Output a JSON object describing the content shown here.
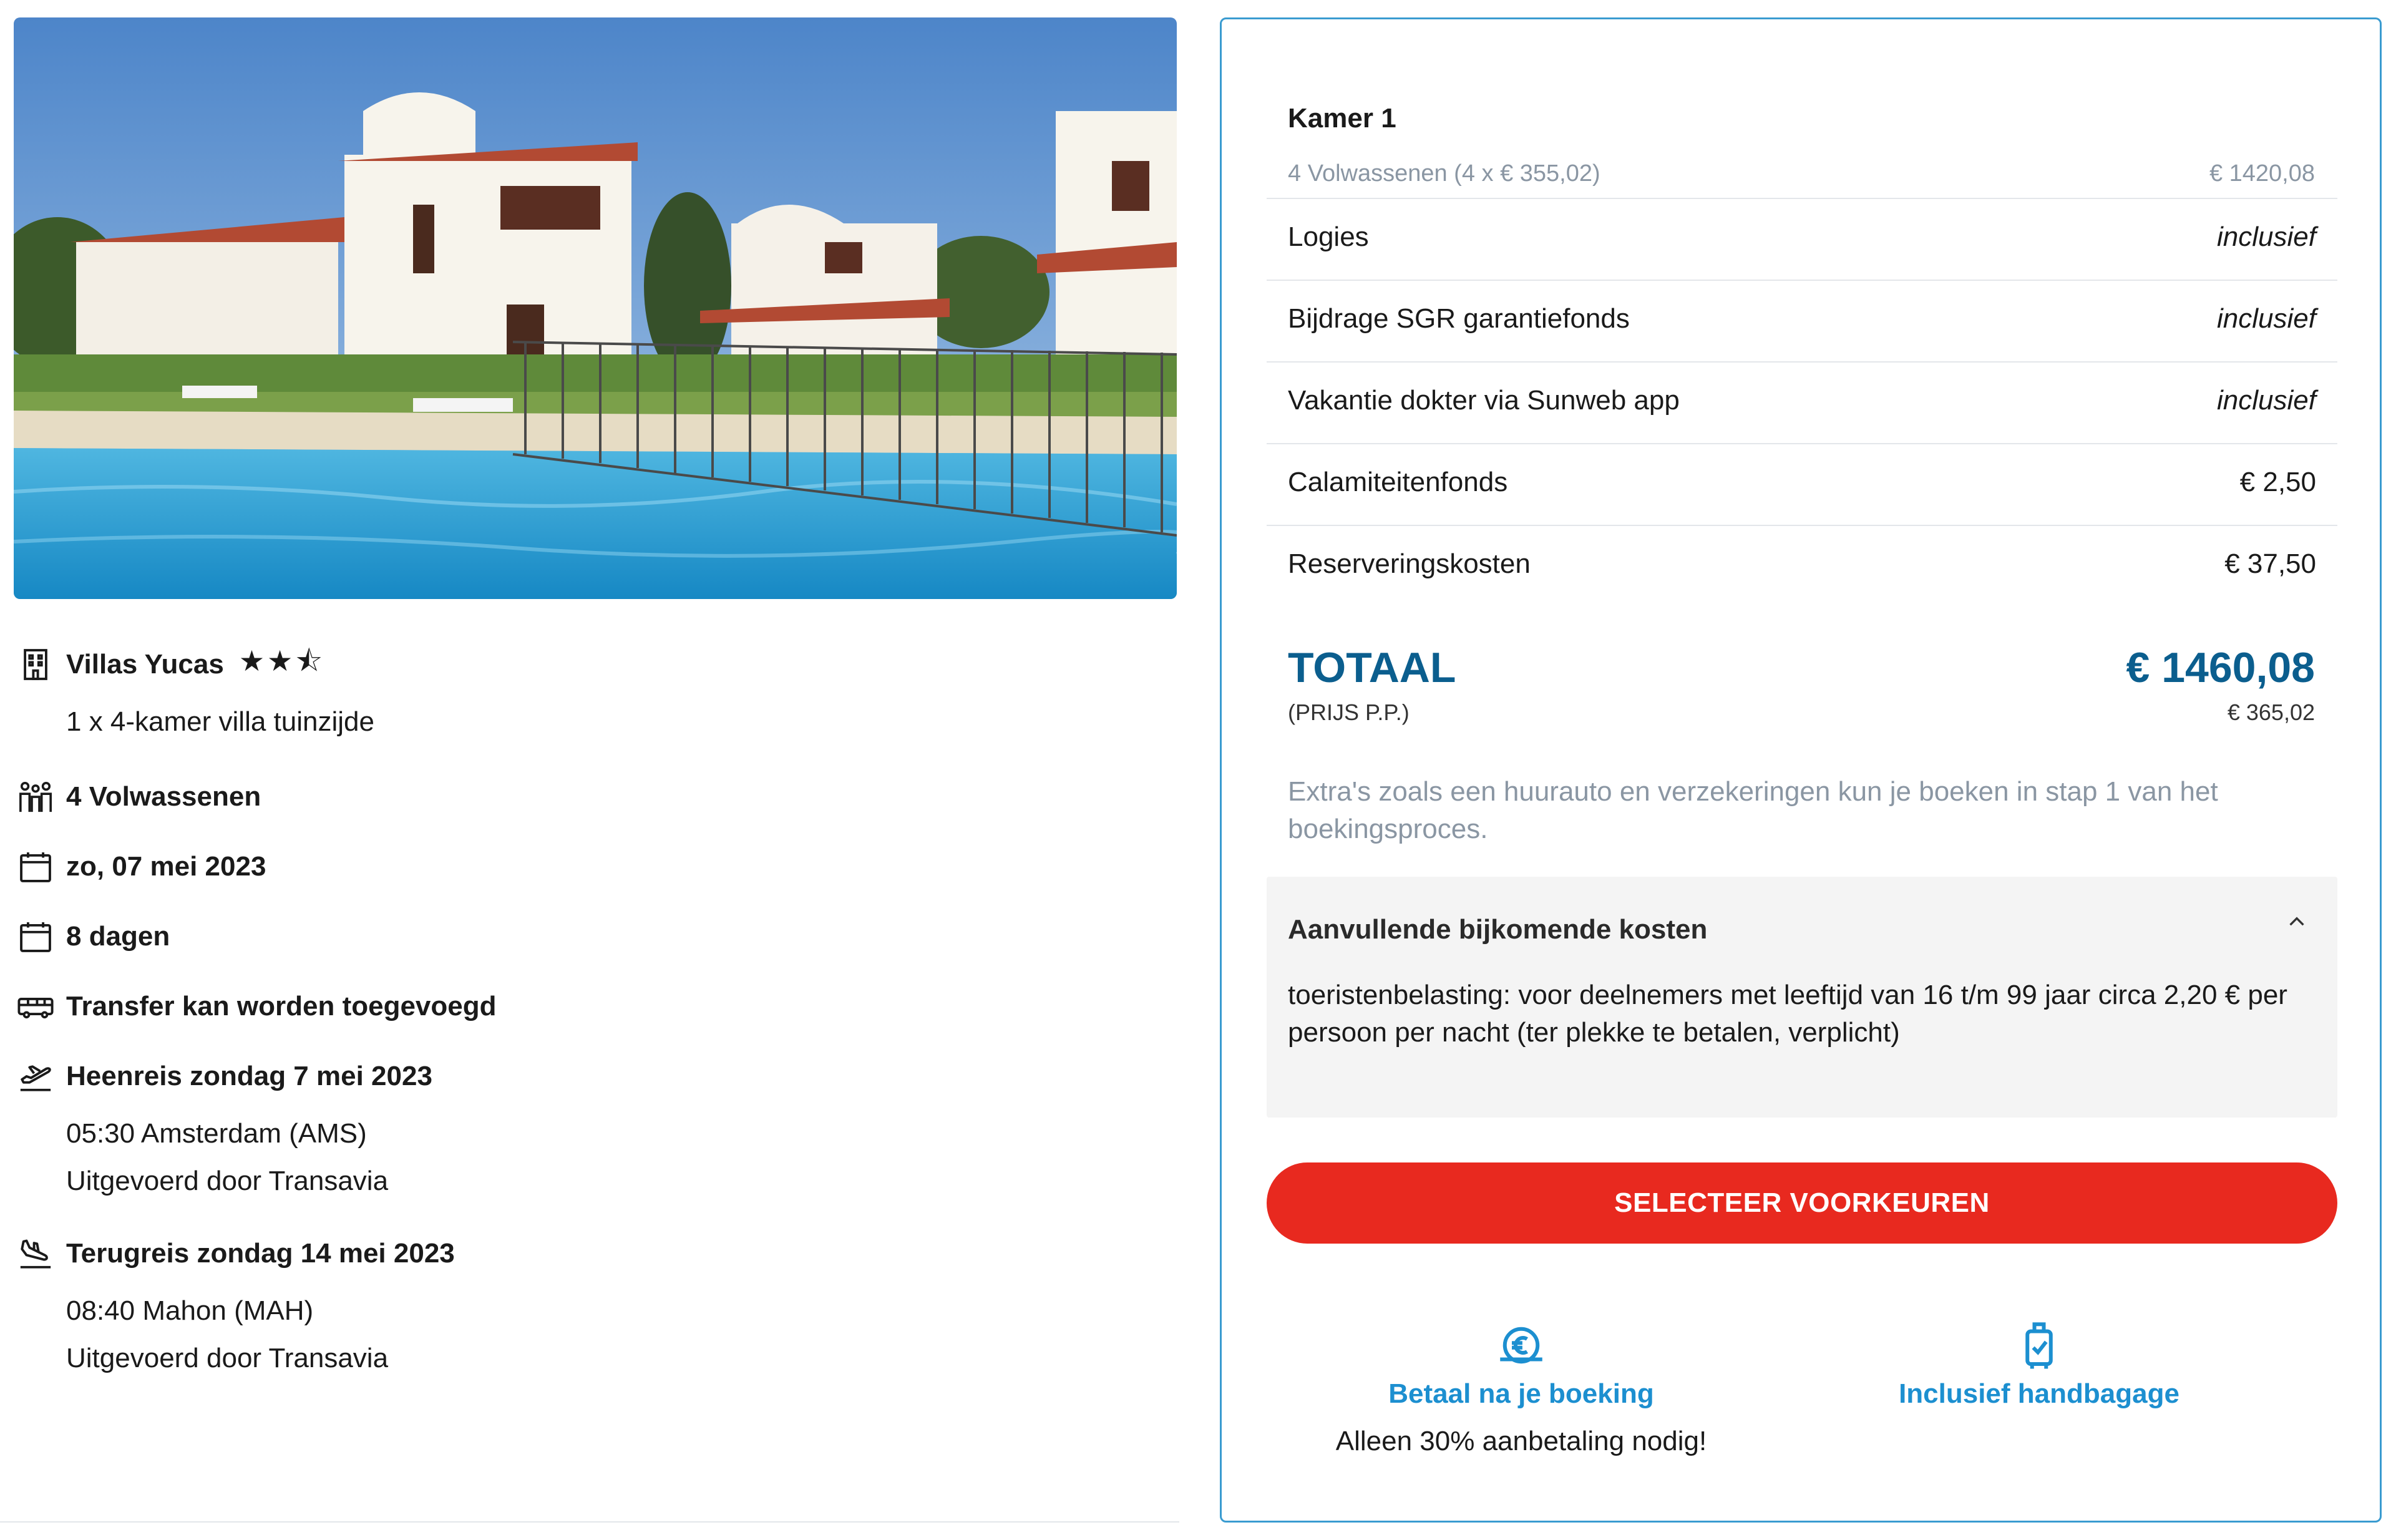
{
  "hotel": {
    "photo_alt": "villas-pool-photo",
    "name": "Villas Yucas",
    "stars": "★★⯪",
    "room": "1 x 4-kamer villa tuinzijde"
  },
  "trip": {
    "travellers": "4 Volwassenen",
    "date": "zo, 07 mei 2023",
    "duration": "8 dagen",
    "transfer": "Transfer kan worden toegevoegd",
    "outbound": {
      "title": "Heenreis zondag 7 mei 2023",
      "time": "05:30 Amsterdam (AMS)",
      "carrier": "Uitgevoerd door Transavia"
    },
    "return": {
      "title": "Terugreis zondag 14 mei 2023",
      "time": "08:40 Mahon (MAH)",
      "carrier": "Uitgevoerd door Transavia"
    }
  },
  "price": {
    "room_title": "Kamer 1",
    "room_sub": "4 Volwassenen (4 x € 355,02)",
    "room_price": "€ 1420,08",
    "lines": [
      {
        "label": "Logies",
        "value": "inclusief"
      },
      {
        "label": "Bijdrage SGR garantiefonds",
        "value": "inclusief"
      },
      {
        "label": "Vakantie dokter via Sunweb app",
        "value": "inclusief"
      },
      {
        "label": "Calamiteitenfonds",
        "value": "€ 2,50"
      },
      {
        "label": "Reserveringskosten",
        "value": "€ 37,50"
      }
    ],
    "total_label": "TOTAAL",
    "total_amount": "€ 1460,08",
    "pp_label": "(PRIJS P.P.)",
    "pp_amount": "€ 365,02",
    "extras_note": "Extra's zoals een huurauto en verzekeringen kun je boeken in stap 1 van het boekingsproces."
  },
  "additional_costs": {
    "title": "Aanvullende bijkomende kosten",
    "body": "toeristenbelasting: voor deelnemers met leeftijd van 16 t/m 99 jaar circa 2,20 € per persoon per nacht (ter plekke te betalen, verplicht)"
  },
  "cta": {
    "label": "SELECTEER VOORKEUREN"
  },
  "usps": [
    {
      "icon": "euro-payment-icon",
      "title": "Betaal na je boeking",
      "desc": "Alleen 30% aanbetaling nodig!"
    },
    {
      "icon": "hand-luggage-icon",
      "title": "Inclusief handbagage",
      "desc": ""
    }
  ],
  "colors": {
    "accent_blue": "#0b5e8e",
    "link_blue": "#1c8fd0",
    "cta_red": "#e8291f",
    "panel_border": "#3a9bd0",
    "muted_text": "#8a96a3"
  }
}
